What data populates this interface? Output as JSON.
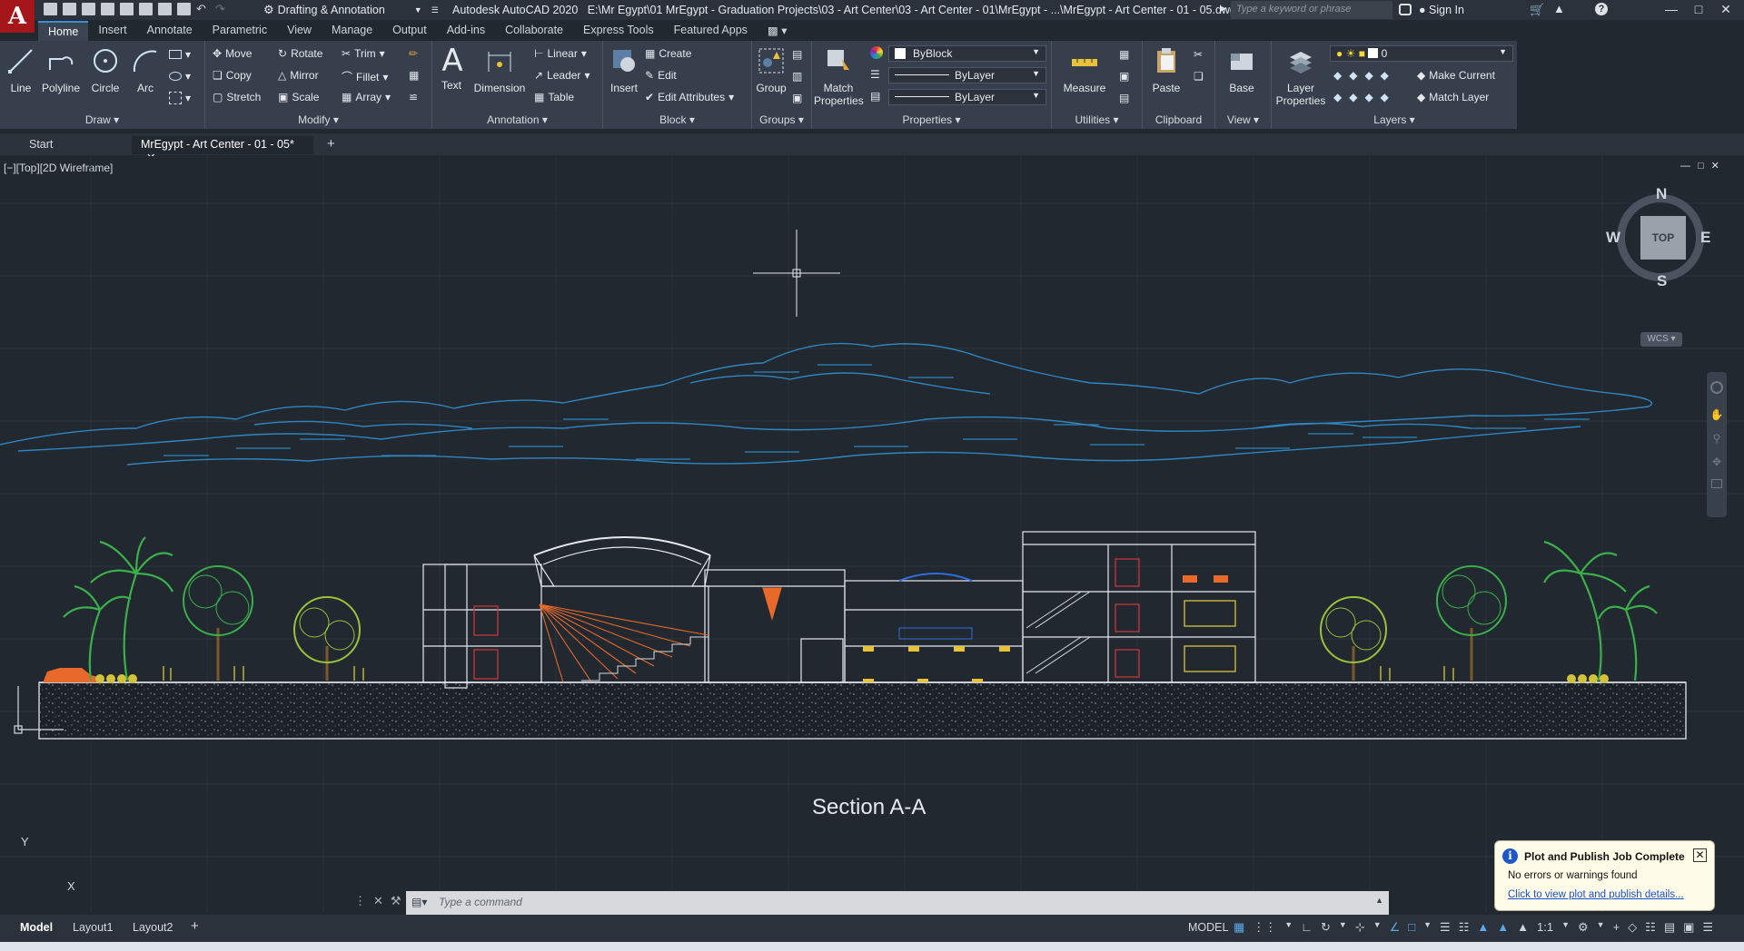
{
  "window": {
    "app_title": "Autodesk AutoCAD 2020",
    "file_path": "E:\\Mr Egypt\\01 MrEgypt - Graduation Projects\\03 - Art Center\\03 - Art Center - 01\\MrEgypt - ...\\MrEgypt - Art Center - 01 - 05.dwg",
    "workspace": "Drafting & Annotation",
    "search_placeholder": "Type a keyword or phrase",
    "sign_in": "Sign In",
    "logo_letter": "A"
  },
  "ribbon_tabs": [
    "Home",
    "Insert",
    "Annotate",
    "Parametric",
    "View",
    "Manage",
    "Output",
    "Add-ins",
    "Collaborate",
    "Express Tools",
    "Featured Apps"
  ],
  "ribbon": {
    "draw": {
      "title": "Draw",
      "line": "Line",
      "polyline": "Polyline",
      "circle": "Circle",
      "arc": "Arc"
    },
    "modify": {
      "title": "Modify",
      "move": "Move",
      "rotate": "Rotate",
      "trim": "Trim",
      "copy": "Copy",
      "mirror": "Mirror",
      "fillet": "Fillet",
      "stretch": "Stretch",
      "scale": "Scale",
      "array": "Array"
    },
    "annotation": {
      "title": "Annotation",
      "text": "Text",
      "dimension": "Dimension",
      "linear": "Linear",
      "leader": "Leader",
      "table": "Table"
    },
    "block": {
      "title": "Block",
      "insert": "Insert",
      "create": "Create",
      "edit": "Edit",
      "edit_attributes": "Edit Attributes"
    },
    "groups": {
      "title": "Groups",
      "group": "Group"
    },
    "properties": {
      "title": "Properties",
      "match": "Match Properties",
      "color": "ByBlock",
      "linetype": "ByLayer",
      "lineweight": "ByLayer"
    },
    "utilities": {
      "title": "Utilities",
      "measure": "Measure"
    },
    "clipboard": {
      "title": "Clipboard",
      "paste": "Paste"
    },
    "view": {
      "title": "View",
      "base": "Base"
    },
    "layers": {
      "title": "Layers",
      "layer_properties": "Layer Properties",
      "current_layer": "0",
      "make_current": "Make Current",
      "match_layer": "Match Layer"
    }
  },
  "doc_tabs": [
    "Start",
    "MrEgypt - Art Center - 01 - 05*"
  ],
  "viewport": {
    "label": "[−][Top][2D Wireframe]",
    "caption": "Section A-A",
    "viewcube": {
      "top": "TOP",
      "n": "N",
      "s": "S",
      "e": "E",
      "w": "W",
      "wcs": "WCS"
    },
    "ucs_x": "X",
    "ucs_y": "Y"
  },
  "command_placeholder": "Type  a  command",
  "layout_tabs": [
    "Model",
    "Layout1",
    "Layout2"
  ],
  "status": {
    "model": "MODEL",
    "scale": "1:1"
  },
  "notification": {
    "title": "Plot and Publish Job Complete",
    "message": "No errors or warnings found",
    "link": "Click to view plot and publish details..."
  },
  "colors": {
    "background": "#212830",
    "clouds": "#2f86c0",
    "orange": "#e8692a",
    "trees": "#3bb04a",
    "accent": "#3b8fd6"
  }
}
